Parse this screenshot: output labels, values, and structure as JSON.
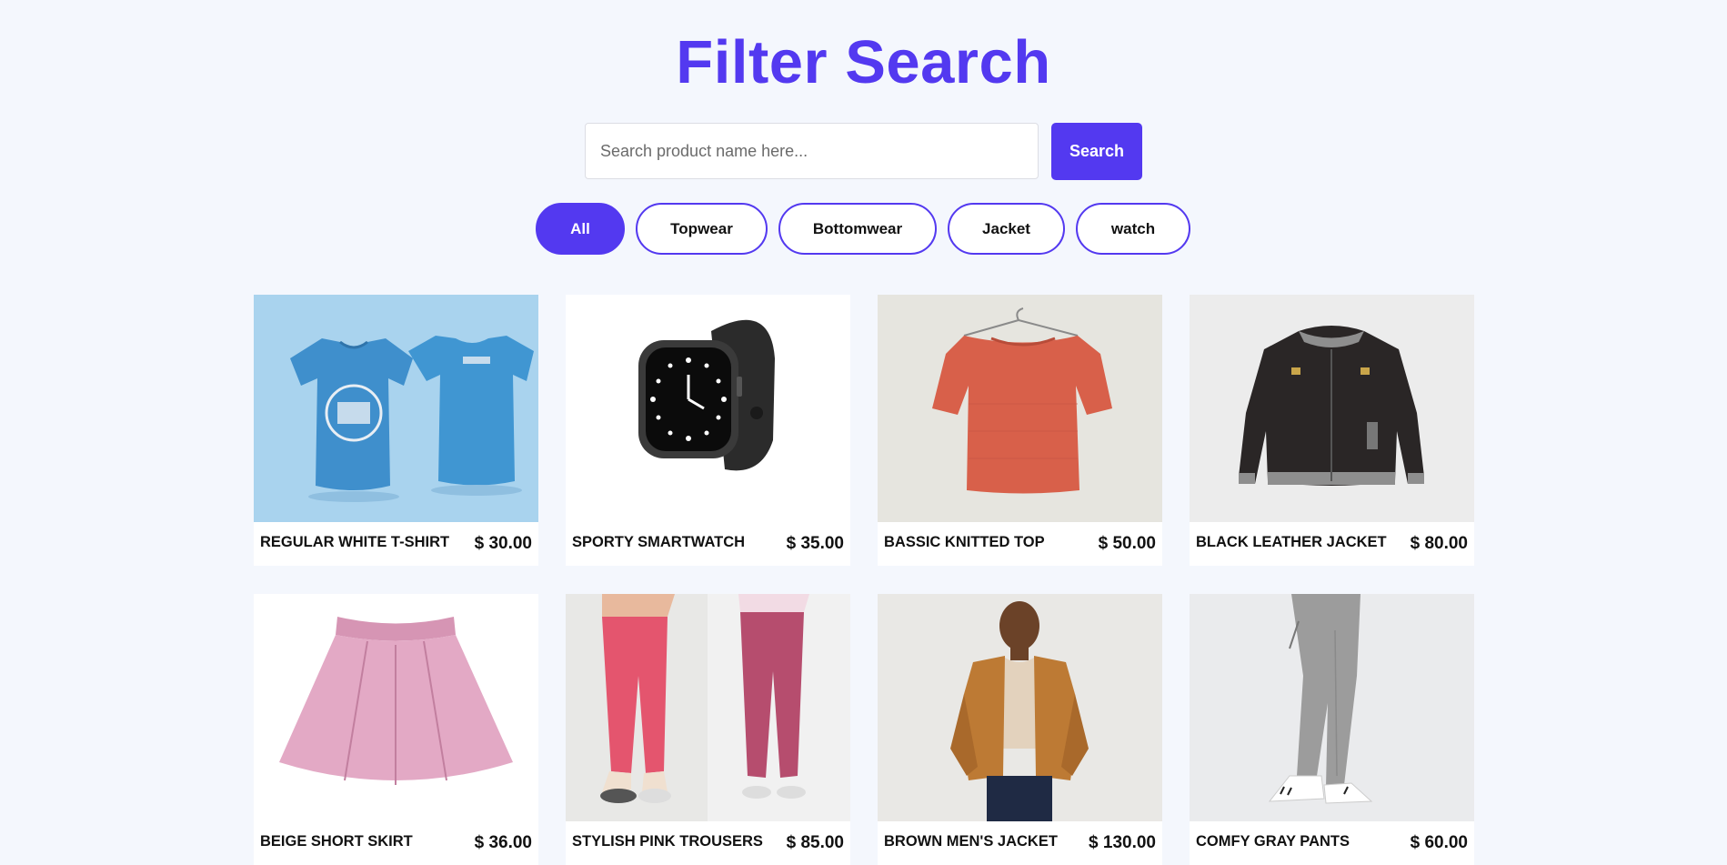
{
  "header": {
    "title": "Filter Search"
  },
  "search": {
    "placeholder": "Search product name here...",
    "button_label": "Search"
  },
  "filters": [
    {
      "label": "All",
      "active": true
    },
    {
      "label": "Topwear",
      "active": false
    },
    {
      "label": "Bottomwear",
      "active": false
    },
    {
      "label": "Jacket",
      "active": false
    },
    {
      "label": "watch",
      "active": false
    }
  ],
  "products": [
    {
      "name": "REGULAR WHITE T-SHIRT",
      "price": "$ 30.00",
      "image": "blue-tshirt-image"
    },
    {
      "name": "SPORTY SMARTWATCH",
      "price": "$ 35.00",
      "image": "smartwatch-image"
    },
    {
      "name": "BASSIC KNITTED TOP",
      "price": "$ 50.00",
      "image": "knitted-top-image"
    },
    {
      "name": "BLACK LEATHER JACKET",
      "price": "$ 80.00",
      "image": "black-jacket-image"
    },
    {
      "name": "BEIGE SHORT SKIRT",
      "price": "$ 36.00",
      "image": "pink-skirt-image"
    },
    {
      "name": "STYLISH PINK TROUSERS",
      "price": "$ 85.00",
      "image": "pink-trousers-image"
    },
    {
      "name": "BROWN MEN'S JACKET",
      "price": "$ 130.00",
      "image": "brown-jacket-image"
    },
    {
      "name": "COMFY GRAY PANTS",
      "price": "$ 60.00",
      "image": "gray-pants-image"
    }
  ],
  "colors": {
    "accent": "#5339f0",
    "background": "#f4f7fd"
  }
}
